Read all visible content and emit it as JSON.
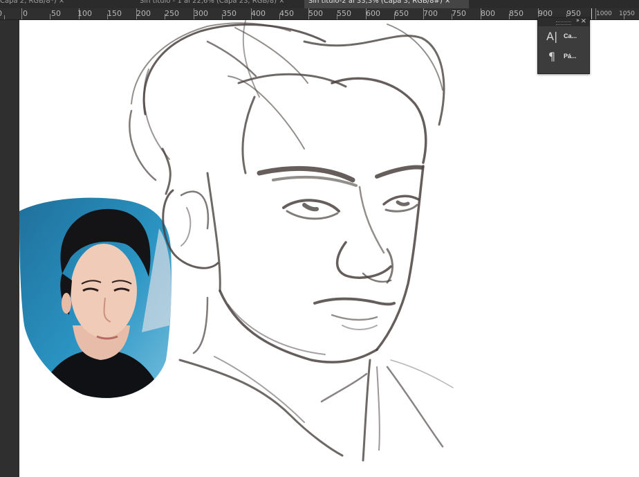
{
  "document_tabs": [
    {
      "label": "Capa 2, RGB/8*) ×",
      "active": false
    },
    {
      "label": "Sin título - 1 al 22,6% (Capa 23, RGB/8) ×",
      "active": false
    },
    {
      "label": "Sin título-2 al 33,3% (Capa 3, RGB/8#) ×",
      "active": true
    }
  ],
  "ruler": {
    "labels": [
      "0",
      "0",
      "50",
      "100",
      "150",
      "200",
      "250",
      "300",
      "350",
      "400",
      "450",
      "500",
      "550",
      "600",
      "650",
      "700",
      "750",
      "800",
      "850",
      "900",
      "950",
      "1000",
      "1050"
    ]
  },
  "panel": {
    "collapse_glyph": "››",
    "close_glyph": "×",
    "items": [
      {
        "icon": "character-icon",
        "glyph": "A|",
        "label": "Ca..."
      },
      {
        "icon": "paragraph-icon",
        "glyph": "¶",
        "label": "Pá..."
      }
    ]
  },
  "colors": {
    "workspace": "#535353",
    "ruler": "#2f2f2f",
    "canvas": "#ffffff",
    "sketch_stroke": "#4a4240",
    "panel": "#3c3c3c"
  }
}
